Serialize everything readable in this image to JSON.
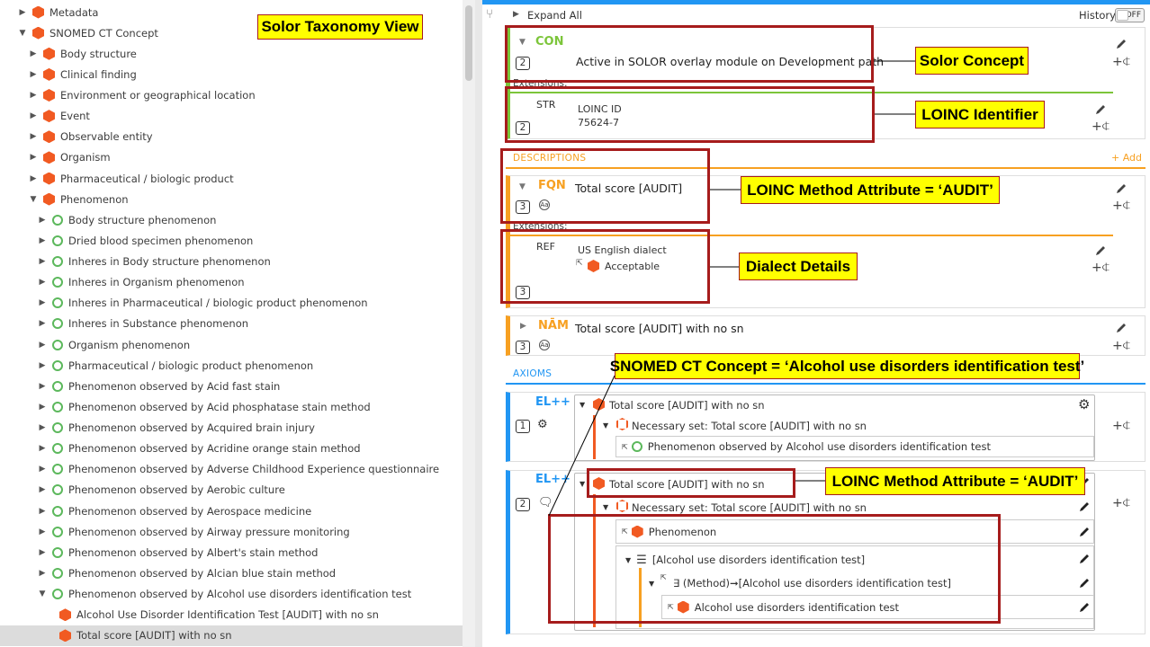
{
  "taxonomy": {
    "items": [
      {
        "label": "Metadata",
        "icon": "hexagon-icon"
      },
      {
        "label": "SNOMED CT Concept",
        "icon": "hexagon-icon"
      },
      {
        "label": "Body structure",
        "icon": "hexagon-icon"
      },
      {
        "label": "Clinical finding",
        "icon": "hexagon-icon"
      },
      {
        "label": "Environment or geographical location",
        "icon": "hexagon-icon"
      },
      {
        "label": "Event",
        "icon": "hexagon-icon"
      },
      {
        "label": "Observable entity",
        "icon": "hexagon-icon"
      },
      {
        "label": "Organism",
        "icon": "hexagon-icon"
      },
      {
        "label": "Pharmaceutical / biologic product",
        "icon": "hexagon-icon"
      },
      {
        "label": "Phenomenon",
        "icon": "hexagon-icon"
      },
      {
        "label": "Body structure phenomenon",
        "icon": "circle-icon"
      },
      {
        "label": "Dried blood specimen phenomenon",
        "icon": "circle-icon"
      },
      {
        "label": "Inheres in Body structure phenomenon",
        "icon": "circle-icon"
      },
      {
        "label": "Inheres in Organism phenomenon",
        "icon": "circle-icon"
      },
      {
        "label": "Inheres in Pharmaceutical / biologic product phenomenon",
        "icon": "circle-icon"
      },
      {
        "label": "Inheres in Substance phenomenon",
        "icon": "circle-icon"
      },
      {
        "label": "Organism phenomenon",
        "icon": "circle-icon"
      },
      {
        "label": "Pharmaceutical / biologic product phenomenon",
        "icon": "circle-icon"
      },
      {
        "label": "Phenomenon observed by Acid fast stain",
        "icon": "circle-icon"
      },
      {
        "label": "Phenomenon observed by Acid phosphatase stain method",
        "icon": "circle-icon"
      },
      {
        "label": "Phenomenon observed by Acquired brain injury",
        "icon": "circle-icon"
      },
      {
        "label": "Phenomenon observed by Acridine orange stain method",
        "icon": "circle-icon"
      },
      {
        "label": "Phenomenon observed by Adverse Childhood Experience questionnaire",
        "icon": "circle-icon"
      },
      {
        "label": "Phenomenon observed by Aerobic culture",
        "icon": "circle-icon"
      },
      {
        "label": "Phenomenon observed by Aerospace medicine",
        "icon": "circle-icon"
      },
      {
        "label": "Phenomenon observed by Airway pressure monitoring",
        "icon": "circle-icon"
      },
      {
        "label": "Phenomenon observed by Albert's stain method",
        "icon": "circle-icon"
      },
      {
        "label": "Phenomenon observed by Alcian blue stain method",
        "icon": "circle-icon"
      },
      {
        "label": "Phenomenon observed by Alcohol use disorders identification test",
        "icon": "circle-icon"
      },
      {
        "label": "Alcohol Use Disorder Identification Test [AUDIT] with no sn",
        "icon": "hexagon-icon"
      },
      {
        "label": "Total score [AUDIT] with no sn",
        "icon": "hexagon-icon"
      }
    ]
  },
  "toolbar": {
    "expand_all": "Expand All",
    "history": "History",
    "history_toggle": "OFF"
  },
  "concept": {
    "label": "CON",
    "count": "2",
    "text": "Active in SOLOR overlay module on Development path",
    "extensions_label": "Extensions:",
    "str_type": "STR",
    "str_count": "2",
    "str_line1": "LOINC ID",
    "str_line2": "75624-7"
  },
  "descriptions": {
    "section_label": "DESCRIPTIONS",
    "add_label": "+ Add",
    "fqn_label": "FQN",
    "fqn_text": "Total score [AUDIT]",
    "fqn_count": "3",
    "extensions_label": "Extensions:",
    "ref_type": "REF",
    "ref_count": "3",
    "ref_line1": "US English dialect",
    "ref_line2": "Acceptable",
    "nam_label": "NĀM",
    "nam_text": "Total score [AUDIT] with no sn",
    "nam_count": "3"
  },
  "axioms": {
    "section_label": "AXIOMS",
    "ax1_label": "EL++",
    "ax1_count": "1",
    "ax1_root": "Total score [AUDIT] with no sn",
    "ax1_set": "Necessary set: Total score [AUDIT] with no sn",
    "ax1_leaf": "Phenomenon observed by Alcohol use disorders identification test",
    "ax2_label": "EL++",
    "ax2_count": "2",
    "ax2_root": "Total score [AUDIT] with no sn",
    "ax2_set": "Necessary set: Total score [AUDIT] with no sn",
    "ax2_phen": "Phenomenon",
    "ax2_group": "[Alcohol use disorders identification test]",
    "ax2_role": "∃ (Method)➞[Alcohol use disorders identification test]",
    "ax2_leaf": "Alcohol use disorders identification test"
  },
  "callouts": {
    "taxonomy": "Solor Taxonomy View",
    "concept": "Solor Concept",
    "loinc_id": "LOINC Identifier",
    "method1": "LOINC Method Attribute =  ‘AUDIT’",
    "dialect": "Dialect Details",
    "snomed": "SNOMED CT Concept = ‘Alcohol use disorders identification test’",
    "method2": "LOINC Method Attribute =  ‘AUDIT’"
  },
  "colors": {
    "accent_blue": "#2196f3",
    "concept_green": "#7cc53a",
    "description_orange": "#f7a021",
    "axiom_orange": "#f15a22",
    "callout_yellow": "#ffff00",
    "callout_border": "#a61c1c"
  }
}
